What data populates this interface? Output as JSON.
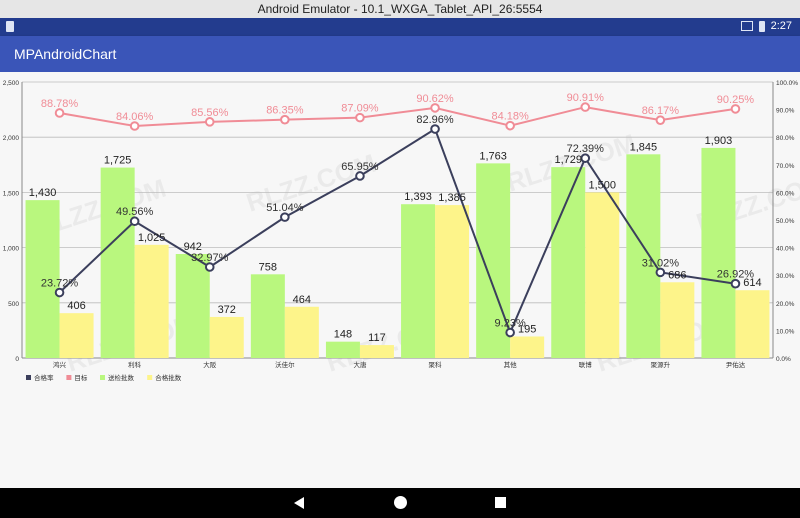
{
  "window": {
    "title": "Android Emulator - 10.1_WXGA_Tablet_API_26:5554"
  },
  "status_bar": {
    "time": "2:27"
  },
  "app_bar": {
    "title": "MPAndroidChart"
  },
  "watermark": "RLZZ.COM",
  "chart_data": {
    "type": "bar",
    "categories": [
      "鸿兴",
      "利科",
      "大阪",
      "沃佳尔",
      "大唐",
      "聚科",
      "其他",
      "联博",
      "聚源升",
      "尹佑达"
    ],
    "left_axis": {
      "ylim": [
        0,
        2500
      ],
      "ticks": [
        "0",
        "500",
        "1,000",
        "1,500",
        "2,000",
        "2,500"
      ]
    },
    "right_axis": {
      "ylim": [
        0,
        100
      ],
      "ticks": [
        "0.0%",
        "10.0%",
        "20.0%",
        "30.0%",
        "40.0%",
        "50.0%",
        "60.0%",
        "70.0%",
        "80.0%",
        "90.0%",
        "100.0%"
      ]
    },
    "grid": true,
    "legend_position": "bottom-left",
    "colors": {
      "line_pass_rate": "#3b3f5c",
      "line_target": "#f08c96",
      "bar_inspected": "#b9f77e",
      "bar_passed": "#fdf48a"
    },
    "bar_series": [
      {
        "name": "送检批数",
        "values": [
          1430,
          1725,
          942,
          758,
          148,
          1393,
          1763,
          1729,
          1845,
          1903
        ],
        "labels": [
          "1,430",
          "1,725",
          "942",
          "758",
          "148",
          "1,393",
          "1,763",
          "1,729",
          "1,845",
          "1,903"
        ]
      },
      {
        "name": "合格批数",
        "values": [
          406,
          1025,
          372,
          464,
          117,
          1385,
          195,
          1500,
          686,
          614
        ],
        "labels": [
          "406",
          "1,025",
          "372",
          "464",
          "117",
          "1,385",
          "195",
          "1,500",
          "686",
          "614"
        ]
      }
    ],
    "line_series": [
      {
        "name": "合格率",
        "values": [
          23.72,
          49.56,
          32.97,
          51.04,
          65.95,
          82.96,
          9.23,
          72.39,
          31.02,
          26.92
        ],
        "labels": [
          "23.72%",
          "49.56%",
          "32.97%",
          "51.04%",
          "65.95%",
          "82.96%",
          "9.23%",
          "72.39%",
          "31.02%",
          "26.92%"
        ]
      },
      {
        "name": "目标",
        "values": [
          88.78,
          84.06,
          85.56,
          86.35,
          87.09,
          90.62,
          84.18,
          90.91,
          86.17,
          90.25
        ],
        "labels": [
          "88.78%",
          "84.06%",
          "85.56%",
          "86.35%",
          "87.09%",
          "90.62%",
          "84.18%",
          "90.91%",
          "86.17%",
          "90.25%"
        ]
      }
    ],
    "legend": [
      "合格率",
      "目标",
      "送检批数",
      "合格批数"
    ]
  }
}
